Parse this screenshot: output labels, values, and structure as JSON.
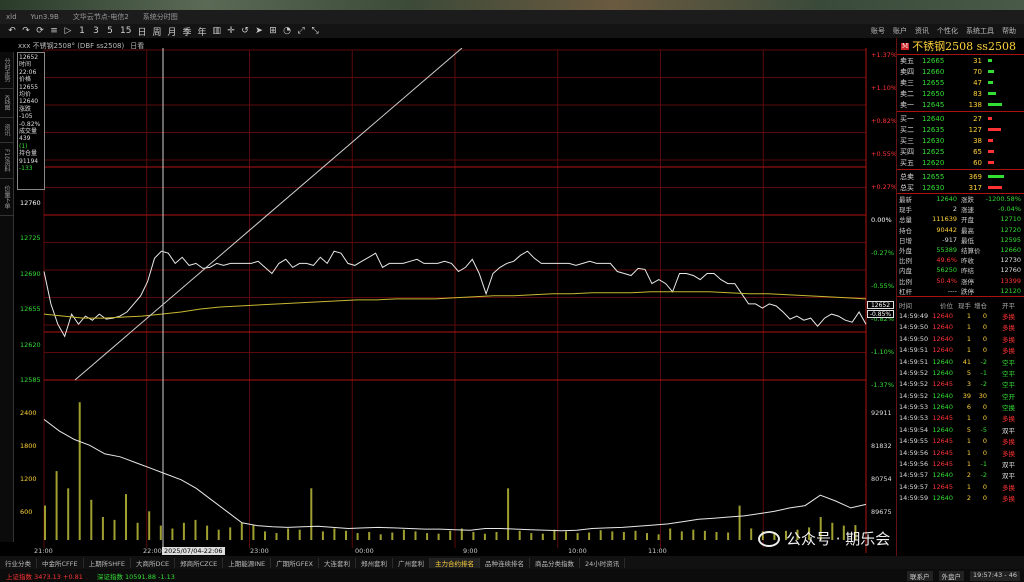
{
  "window": {
    "title_left": "xld",
    "title_version": "Yun3.9B",
    "title_doc": "文华云节点-电信2",
    "title_sys": "系统分时图"
  },
  "menu": [
    "账号",
    "账户",
    "资讯",
    "个性化",
    "系统工具",
    "帮助"
  ],
  "toolbar_icons": [
    "back-icon",
    "forward-icon",
    "refresh-icon",
    "bars-icon",
    "play-icon",
    "1",
    "3",
    "5",
    "15",
    "日",
    "周",
    "月",
    "季",
    "年",
    "chart-icon",
    "cross-icon",
    "undo-icon",
    "arrow-icon",
    "grid-icon",
    "wifi-icon",
    "expand-icon",
    "compress-icon"
  ],
  "chart_header": {
    "text": "xxx 不锈钢2508° (DBF ss2508)",
    "mode": "日看"
  },
  "left_tabs": [
    "分时走势",
    "K线图",
    "资讯",
    "F10资料",
    "价量下单"
  ],
  "infobox": [
    {
      "v": "12652",
      "c": "#dddddd"
    },
    {
      "v": "时间",
      "c": "#dddddd"
    },
    {
      "v": "22:06",
      "c": "#dddddd"
    },
    {
      "v": "价格",
      "c": "#dddddd"
    },
    {
      "v": "12655",
      "c": "#dddddd"
    },
    {
      "v": "均价",
      "c": "#dddddd"
    },
    {
      "v": "12640",
      "c": "#dddddd"
    },
    {
      "v": "涨跌",
      "c": "#dddddd"
    },
    {
      "v": "-105",
      "c": "#dddddd"
    },
    {
      "v": "-0.82%",
      "c": "#dddddd"
    },
    {
      "v": "成交量",
      "c": "#dddddd"
    },
    {
      "v": "439",
      "c": "#dddddd"
    },
    {
      "v": "(1)",
      "c": "#33dd33"
    },
    {
      "v": "持仓量",
      "c": "#dddddd"
    },
    {
      "v": "91194",
      "c": "#dddddd"
    },
    {
      "v": "-133",
      "c": "#33dd33"
    }
  ],
  "chart_data": {
    "type": "line",
    "price_axis": {
      "ylim": [
        12585,
        12795
      ],
      "ticks": [
        12760,
        12725,
        12690,
        12655,
        12620,
        12585
      ]
    },
    "pct_axis": [
      "+1.37%",
      "+1.10%",
      "+0.82%",
      "+0.55%",
      "+0.27%",
      "0.00%",
      "-0.27%",
      "-0.55%",
      "-0.82%",
      "-1.10%",
      "-1.37%"
    ],
    "pct_colors": {
      "pos": "#ff3333",
      "zero": "#ffffff",
      "neg": "#33dd33"
    },
    "x_ticks": [
      "21:00",
      "22:00",
      "2025/07/04-22:06",
      "23:00",
      "00:00",
      "9:00",
      "10:00",
      "11:00"
    ],
    "price_series": [
      12692,
      12660,
      12640,
      12628,
      12650,
      12640,
      12648,
      12644,
      12650,
      12645,
      12646,
      12648,
      12652,
      12660,
      12668,
      12682,
      12705,
      12712,
      12710,
      12700,
      12706,
      12698,
      12700,
      12695,
      12696,
      12700,
      12698,
      12700,
      12700,
      12700,
      12700,
      12702,
      12696,
      12690,
      12700,
      12704,
      12696,
      12700,
      12700,
      12698,
      12706,
      12700,
      12712,
      12710,
      12700,
      12698,
      12702,
      12706,
      12710,
      12696,
      12700,
      12700,
      12700,
      12702,
      12704,
      12700,
      12700,
      12700,
      12702,
      12700,
      12692,
      12696,
      12704,
      12690,
      12670,
      12690,
      12696,
      12700,
      12702,
      12708,
      12712,
      12705,
      12700,
      12700,
      12700,
      12700,
      12700,
      12698,
      12700,
      12702,
      12700,
      12700,
      12700,
      12692,
      12690,
      12688,
      12695,
      12694,
      12680,
      12684,
      12680,
      12672,
      12690,
      12690,
      12688,
      12684,
      12690,
      12690,
      12684,
      12680,
      12680,
      12670,
      12660,
      12660,
      12656,
      12660,
      12658,
      12652,
      12645,
      12648,
      12644,
      12646,
      12638,
      12646,
      12650,
      12648,
      12644,
      12642,
      12652,
      12640
    ],
    "avg_series": [
      12650,
      12648,
      12646,
      12646,
      12647,
      12648,
      12650,
      12652,
      12655,
      12657,
      12658,
      12659,
      12660,
      12661,
      12662,
      12663,
      12664,
      12664,
      12665,
      12665,
      12665,
      12666,
      12667,
      12668,
      12668,
      12669,
      12670,
      12670,
      12671,
      12671,
      12671,
      12672,
      12672,
      12672,
      12672,
      12671,
      12670,
      12670,
      12669,
      12668,
      12667,
      12666,
      12665
    ],
    "vol_axis": {
      "left_ticks": [
        2400,
        1800,
        1200,
        600
      ],
      "right_ticks": [
        92911,
        81832,
        80754,
        89675
      ]
    },
    "vol_series": [
      600,
      1200,
      900,
      2400,
      700,
      400,
      350,
      800,
      300,
      500,
      250,
      200,
      300,
      350,
      250,
      180,
      220,
      300,
      260,
      150,
      120,
      200,
      180,
      900,
      150,
      200,
      160,
      120,
      140,
      100,
      130,
      180,
      150,
      120,
      110,
      160,
      200,
      140,
      110,
      140,
      900,
      160,
      120,
      110,
      180,
      150,
      120,
      130,
      170,
      150,
      140,
      160,
      120,
      100,
      200,
      150,
      180,
      160,
      140,
      130,
      600,
      200,
      150,
      140,
      160,
      180,
      220,
      400,
      300,
      250,
      260
    ],
    "oi_series": [
      2100,
      1900,
      1750,
      1650,
      1500,
      1450,
      1350,
      1250,
      1150,
      1050,
      900,
      700,
      500,
      300,
      250,
      230,
      220,
      230,
      240,
      220,
      200,
      210,
      220,
      210,
      200,
      190,
      190,
      180,
      170,
      200,
      200,
      190,
      180,
      170,
      160,
      170,
      200,
      210,
      220,
      240,
      260,
      280,
      320,
      360,
      380,
      400,
      420,
      460,
      500,
      560,
      600,
      780,
      680,
      560,
      620
    ]
  },
  "order_book": {
    "title": "不锈钢2508",
    "code": "ss2508",
    "asks": [
      {
        "label": "卖五",
        "price": "12665",
        "vol": "31",
        "bar": 4
      },
      {
        "label": "卖四",
        "price": "12660",
        "vol": "70",
        "bar": 6
      },
      {
        "label": "卖三",
        "price": "12655",
        "vol": "47",
        "bar": 5
      },
      {
        "label": "卖二",
        "price": "12650",
        "vol": "83",
        "bar": 8
      },
      {
        "label": "卖一",
        "price": "12645",
        "vol": "138",
        "bar": 14
      }
    ],
    "bids": [
      {
        "label": "买一",
        "price": "12640",
        "vol": "27",
        "bar": 4
      },
      {
        "label": "买二",
        "price": "12635",
        "vol": "127",
        "bar": 13
      },
      {
        "label": "买三",
        "price": "12630",
        "vol": "38",
        "bar": 5
      },
      {
        "label": "买四",
        "price": "12625",
        "vol": "65",
        "bar": 6
      },
      {
        "label": "买五",
        "price": "12620",
        "vol": "60",
        "bar": 6
      }
    ],
    "totals": [
      {
        "label": "总卖",
        "price": "12655",
        "vol": "369",
        "color": "#33dd33",
        "bar": 16
      },
      {
        "label": "总买",
        "price": "12630",
        "vol": "317",
        "color": "#ff3333",
        "bar": 14
      }
    ]
  },
  "stats": [
    {
      "a": "最新",
      "b": "12640",
      "bc": "#33dd33",
      "c": "涨跌",
      "d": "-1200.58%",
      "dc": "#33dd33"
    },
    {
      "a": "现手",
      "b": "2",
      "bc": "#dddddd",
      "c": "涨速",
      "d": "-0.04%",
      "dc": "#33dd33"
    },
    {
      "a": "总量",
      "b": "111639",
      "bc": "#ffd23a",
      "c": "开盘",
      "d": "12710",
      "dc": "#33dd33"
    },
    {
      "a": "持仓",
      "b": "90442",
      "bc": "#ffd23a",
      "c": "最高",
      "d": "12720",
      "dc": "#33dd33"
    },
    {
      "a": "日增",
      "b": "-917",
      "bc": "#dddddd",
      "c": "最低",
      "d": "12595",
      "dc": "#33dd33"
    },
    {
      "a": "外盘",
      "b": "55389",
      "bc": "#33dd33",
      "c": "结算价",
      "d": "12660",
      "dc": "#33dd33"
    },
    {
      "a": "比例",
      "b": "49.6%",
      "bc": "#ff3333",
      "c": "昨收",
      "d": "12730",
      "dc": "#dddddd"
    },
    {
      "a": "内盘",
      "b": "56250",
      "bc": "#33dd33",
      "c": "昨结",
      "d": "12760",
      "dc": "#dddddd"
    },
    {
      "a": "比例",
      "b": "50.4%",
      "bc": "#ff3333",
      "c": "涨停",
      "d": "13399",
      "dc": "#ff3333"
    },
    {
      "a": "杠杆",
      "b": "----",
      "bc": "#dddddd",
      "c": "跌停",
      "d": "12120",
      "dc": "#33dd33"
    }
  ],
  "ticks_header": {
    "time": "时间",
    "price": "价位",
    "hand": "现手",
    "inc": "增仓",
    "type": "开平"
  },
  "ticks": [
    {
      "t": "14:59:49",
      "p": "12640",
      "h": "1",
      "i": "0",
      "ty": "多换",
      "hc": "#ff3333",
      "ic": "#ffd23a",
      "tc": "#ff3333"
    },
    {
      "t": "14:59:50",
      "p": "12640",
      "h": "1",
      "i": "0",
      "ty": "多换",
      "hc": "#ff3333",
      "ic": "#ffd23a",
      "tc": "#ff3333"
    },
    {
      "t": "14:59:50",
      "p": "12640",
      "h": "1",
      "i": "0",
      "ty": "多换",
      "hc": "#ff3333",
      "ic": "#ffd23a",
      "tc": "#ff3333"
    },
    {
      "t": "14:59:51",
      "p": "12640",
      "h": "1",
      "i": "0",
      "ty": "多换",
      "hc": "#ff3333",
      "ic": "#ffd23a",
      "tc": "#ff3333"
    },
    {
      "t": "14:59:51",
      "p": "12640",
      "h": "41",
      "i": "-2",
      "ty": "空平",
      "hc": "#33dd33",
      "ic": "#33dd33",
      "tc": "#33dd33"
    },
    {
      "t": "14:59:52",
      "p": "12640",
      "h": "5",
      "i": "-1",
      "ty": "空平",
      "hc": "#33dd33",
      "ic": "#33dd33",
      "tc": "#33dd33"
    },
    {
      "t": "14:59:52",
      "p": "12645",
      "h": "3",
      "i": "-2",
      "ty": "空平",
      "hc": "#ff3333",
      "ic": "#33dd33",
      "tc": "#33dd33"
    },
    {
      "t": "14:59:52",
      "p": "12640",
      "h": "39",
      "i": "30",
      "ty": "空开",
      "hc": "#33dd33",
      "ic": "#ffd23a",
      "tc": "#33dd33"
    },
    {
      "t": "14:59:53",
      "p": "12640",
      "h": "6",
      "i": "0",
      "ty": "空换",
      "hc": "#33dd33",
      "ic": "#ffd23a",
      "tc": "#33dd33"
    },
    {
      "t": "14:59:53",
      "p": "12645",
      "h": "1",
      "i": "0",
      "ty": "多换",
      "hc": "#ff3333",
      "ic": "#ffd23a",
      "tc": "#ff3333"
    },
    {
      "t": "14:59:54",
      "p": "12640",
      "h": "5",
      "i": "-5",
      "ty": "双平",
      "hc": "#33dd33",
      "ic": "#33dd33",
      "tc": "#dddddd"
    },
    {
      "t": "14:59:55",
      "p": "12645",
      "h": "1",
      "i": "0",
      "ty": "多换",
      "hc": "#ff3333",
      "ic": "#ffd23a",
      "tc": "#ff3333"
    },
    {
      "t": "14:59:56",
      "p": "12645",
      "h": "1",
      "i": "0",
      "ty": "多换",
      "hc": "#ff3333",
      "ic": "#ffd23a",
      "tc": "#ff3333"
    },
    {
      "t": "14:59:56",
      "p": "12645",
      "h": "1",
      "i": "-1",
      "ty": "双平",
      "hc": "#ff3333",
      "ic": "#33dd33",
      "tc": "#dddddd"
    },
    {
      "t": "14:59:57",
      "p": "12640",
      "h": "2",
      "i": "-2",
      "ty": "双平",
      "hc": "#33dd33",
      "ic": "#33dd33",
      "tc": "#dddddd"
    },
    {
      "t": "14:59:57",
      "p": "12645",
      "h": "1",
      "i": "0",
      "ty": "多换",
      "hc": "#ff3333",
      "ic": "#ffd23a",
      "tc": "#ff3333"
    },
    {
      "t": "14:59:59",
      "p": "12640",
      "h": "2",
      "i": "0",
      "ty": "多换",
      "hc": "#33dd33",
      "ic": "#ffd23a",
      "tc": "#ff3333"
    }
  ],
  "bottom_tabs": [
    "行业分类",
    "中金所CFFE",
    "上期所SHFE",
    "大商所DCE",
    "郑商所CZCE",
    "上期能源INE",
    "广期所GFEX",
    "大连套利",
    "郑州套利",
    "广州套利",
    "主力合约排名",
    "品种连续排名",
    "商品分类指数",
    "24小时资讯"
  ],
  "bottom_active": 10,
  "status": {
    "s1": "上证指数 3473.13 +0.81",
    "s2": "深证指数 10591.88 -1.13",
    "btn1": "联系户",
    "btn2": "外盘户",
    "time": "19:57:43 - 46"
  },
  "watermark": "公众号 · 期乐会",
  "latest_price_tag": "12652",
  "latest_pct_tag": "-0.85%"
}
